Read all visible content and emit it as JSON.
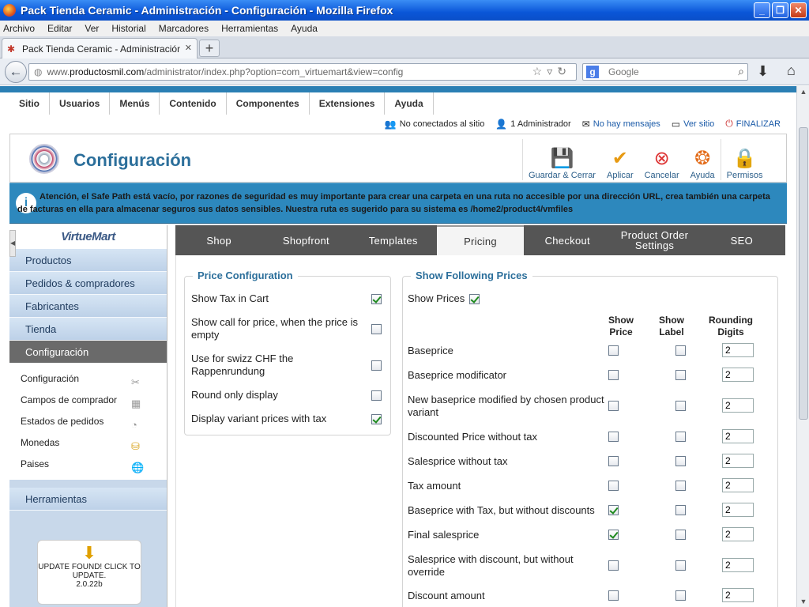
{
  "window": {
    "title": "Pack Tienda Ceramic - Administración - Configuración - Mozilla Firefox"
  },
  "menubar": [
    "Archivo",
    "Editar",
    "Ver",
    "Historial",
    "Marcadores",
    "Herramientas",
    "Ayuda"
  ],
  "browser": {
    "tab_title": "Pack Tienda Ceramic - Administración - Confi...",
    "url_prefix": "www.",
    "url_domain": "productosmil.com",
    "url_rest": "/administrator/index.php?option=com_virtuemart&view=config",
    "search_placeholder": "Google"
  },
  "admin_menu": [
    "Sitio",
    "Usuarios",
    "Menús",
    "Contenido",
    "Componentes",
    "Extensiones",
    "Ayuda"
  ],
  "status": {
    "offline": "No conectados al sitio",
    "admins": "1 Administrador",
    "messages": "No hay mensajes",
    "view_site": "Ver sitio",
    "logout": "FINALIZAR"
  },
  "header": {
    "title": "Configuración",
    "toolbar": {
      "save_close": "Guardar & Cerrar",
      "apply": "Aplicar",
      "cancel": "Cancelar",
      "help": "Ayuda",
      "permissions": "Permisos"
    }
  },
  "warning": "Atención, el Safe Path está vacío, por razones de seguridad es muy importante para crear una carpeta en una ruta no accesible por una dirección URL, crea también una carpeta de facturas en ella para almacenar seguros sus datos sensibles. Nuestra ruta es sugerido para su sistema es /home2/product4/vmfiles",
  "sidebar": {
    "logo": "VirtueMart",
    "items": [
      "Productos",
      "Pedidos & compradores",
      "Fabricantes",
      "Tienda",
      "Configuración"
    ],
    "subitems": [
      "Configuración",
      "Campos de comprador",
      "Estados de pedidos",
      "Monedas",
      "Paises"
    ],
    "tools": "Herramientas",
    "update": {
      "line1": "UPDATE FOUND! CLICK TO UPDATE.",
      "version": "2.0.22b"
    }
  },
  "tabs": [
    "Shop",
    "Shopfront",
    "Templates",
    "Pricing",
    "Checkout",
    "Product Order Settings",
    "SEO"
  ],
  "active_tab": "Pricing",
  "price_config": {
    "legend": "Price Configuration",
    "rows": [
      {
        "label": "Show Tax in Cart",
        "checked": true
      },
      {
        "label": "Show call for price, when the price is empty",
        "checked": false
      },
      {
        "label": "Use for swizz CHF the Rappenrundung",
        "checked": false
      },
      {
        "label": "Round only display",
        "checked": false
      },
      {
        "label": "Display variant prices with tax",
        "checked": true
      }
    ]
  },
  "prices": {
    "legend": "Show Following Prices",
    "show_prices_label": "Show Prices",
    "show_prices_checked": true,
    "col_show_price": "Show Price",
    "col_show_label": "Show Label",
    "col_rounding": "Rounding Digits",
    "rows": [
      {
        "label": "Baseprice",
        "price": false,
        "show_label": false,
        "digits": "2"
      },
      {
        "label": "Baseprice modificator",
        "price": false,
        "show_label": false,
        "digits": "2"
      },
      {
        "label": "New baseprice modified by chosen product variant",
        "price": false,
        "show_label": false,
        "digits": "2"
      },
      {
        "label": "Discounted Price without tax",
        "price": false,
        "show_label": false,
        "digits": "2"
      },
      {
        "label": "Salesprice without tax",
        "price": false,
        "show_label": false,
        "digits": "2"
      },
      {
        "label": "Tax amount",
        "price": false,
        "show_label": false,
        "digits": "2"
      },
      {
        "label": "Baseprice with Tax, but without discounts",
        "price": true,
        "show_label": false,
        "digits": "2"
      },
      {
        "label": "Final salesprice",
        "price": true,
        "show_label": false,
        "digits": "2"
      },
      {
        "label": "Salesprice with discount, but without override",
        "price": false,
        "show_label": false,
        "digits": "2"
      },
      {
        "label": "Discount amount",
        "price": false,
        "show_label": false,
        "digits": "2"
      }
    ]
  }
}
